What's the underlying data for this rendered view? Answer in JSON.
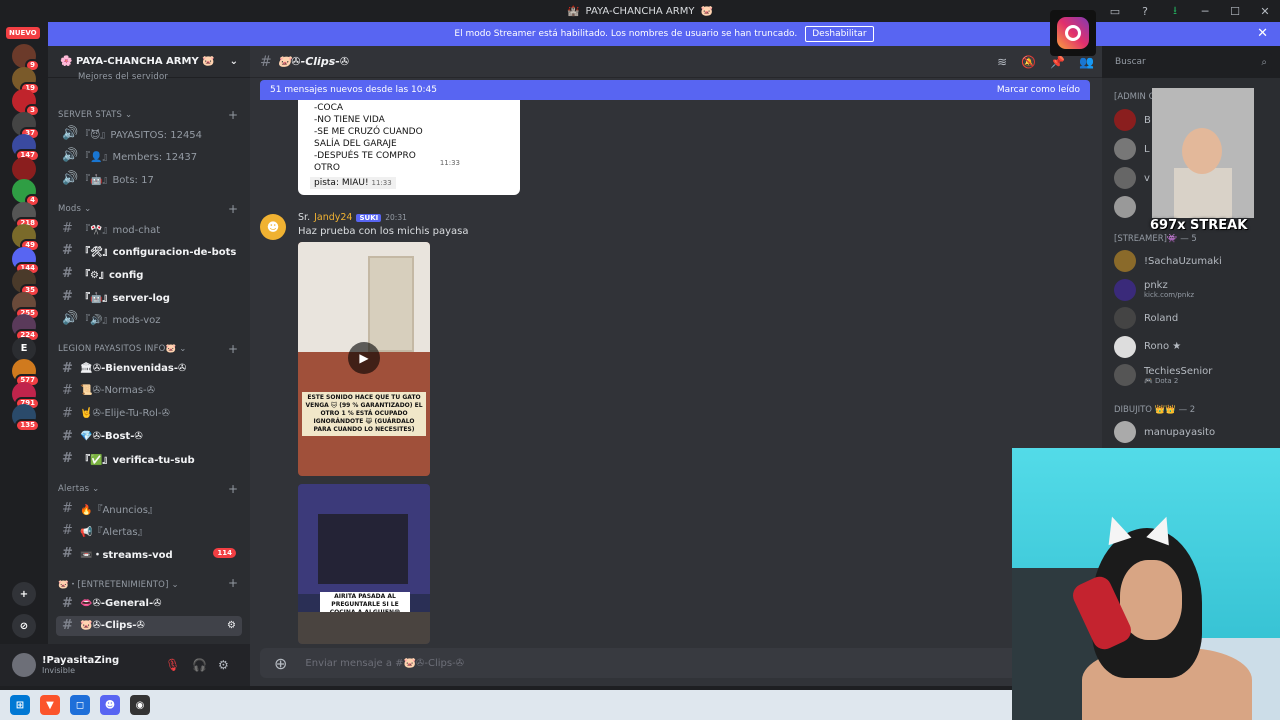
{
  "window": {
    "title": "PAYA-CHANCHA ARMY"
  },
  "banner": {
    "text": "El modo Streamer está habilitado. Los nombres de usuario se han truncado.",
    "button": "Deshabilitar"
  },
  "rail": {
    "nuevo": "NUEVO",
    "servers": [
      {
        "label": "",
        "badge": "9",
        "color": "#6b3a2a"
      },
      {
        "label": "",
        "badge": "19",
        "color": "#7a5a2a"
      },
      {
        "label": "",
        "badge": "3",
        "color": "#c0242c"
      },
      {
        "label": "",
        "badge": "37",
        "color": "#444"
      },
      {
        "label": "",
        "badge": "147",
        "color": "#3a4aa0"
      },
      {
        "label": "",
        "badge": "",
        "color": "#8a1e1e"
      },
      {
        "label": "",
        "badge": "4",
        "color": "#2f9e44"
      },
      {
        "label": "",
        "badge": "218",
        "color": "#555"
      },
      {
        "label": "",
        "badge": "49",
        "color": "#7a6a2a"
      },
      {
        "label": "",
        "badge": "144",
        "color": "#5865f2"
      },
      {
        "label": "",
        "badge": "35",
        "color": "#4a3a2a"
      },
      {
        "label": "",
        "badge": "255",
        "color": "#6a4a3a"
      },
      {
        "label": "",
        "badge": "224",
        "color": "#5a3a5a"
      },
      {
        "label": "E",
        "badge": "",
        "color": "#2b2d31"
      },
      {
        "label": "",
        "badge": "577",
        "color": "#d07a1e"
      },
      {
        "label": "",
        "badge": "791",
        "color": "#c0244c"
      },
      {
        "label": "",
        "badge": "135",
        "color": "#2a4a6a"
      }
    ]
  },
  "server": {
    "name": "PAYA-CHANCHA ARMY"
  },
  "sidebar": {
    "partial_top": "Mejores del servidor",
    "cat_stats": "SERVER STATS",
    "stats": [
      {
        "label": "『😈』PAYASITOS: 12454"
      },
      {
        "label": "『👤』Members: 12437"
      },
      {
        "label": "『🤖』Bots: 17"
      }
    ],
    "cat_mods": "Mods",
    "mods": [
      {
        "label": "『🎌』mod-chat",
        "unread": false
      },
      {
        "label": "『🛠』configuracion-de-bots",
        "unread": true
      },
      {
        "label": "『⚙』config",
        "unread": true
      },
      {
        "label": "『🤖』server-log",
        "unread": true
      },
      {
        "label": "『🔊』mods-voz",
        "unread": false
      }
    ],
    "cat_legion": "LEGION PAYASITOS INFO🐷",
    "legion": [
      {
        "label": "🏛✇-Bienvenidas-✇",
        "unread": true
      },
      {
        "label": "📜✇-Normas-✇",
        "unread": false
      },
      {
        "label": "🤘✇-Elije-Tu-Rol-✇",
        "unread": false
      },
      {
        "label": "💎✇-Bost-✇",
        "unread": true
      },
      {
        "label": "『✅』verifica-tu-sub",
        "unread": true
      }
    ],
    "cat_alertas": "Alertas",
    "alertas": [
      {
        "label": "🔥『Anuncios』",
        "unread": false,
        "count": ""
      },
      {
        "label": "📢『Alertas』",
        "unread": false,
        "count": ""
      },
      {
        "label": "📼・streams-vod",
        "unread": true,
        "count": "114"
      }
    ],
    "cat_entret": "🐷・[ENTRETENIMIENTO]",
    "entret": [
      {
        "label": "👄✇-General-✇",
        "unread": true
      },
      {
        "label": "🐷✇-Clips-✇",
        "unread": true,
        "selected": true
      }
    ]
  },
  "user": {
    "name": "!PayasitaZing",
    "status": "Invisible"
  },
  "chat": {
    "channel": "🐷✇-Clips-✇",
    "new_messages": "51 mensajes nuevos desde las 10:45",
    "mark_read": "Marcar como leído",
    "img_lines": [
      "-COCA",
      "-NO TIENE VIDA",
      "-SE ME CRUZÓ CUANDO",
      "SALÍA DEL GARAJE",
      "-DESPUÉS TE COMPRO",
      "OTRO"
    ],
    "img_time": "11:33",
    "img_pista": "pista: MIAU!",
    "img_pista_time": "11:33",
    "msg_author_prefix": "Sr. ",
    "msg_author": "Jandy24",
    "msg_tag": "SUKI",
    "msg_time": "20:31",
    "msg_text": "Haz prueba con los michis payasa",
    "vid1_caption": "ESTE SONIDO HACE QUE TU GATO VENGA 🐱 (99 % GARANTIZADO) EL OTRO 1 % ESTÁ OCUPADO IGNORÁNDOTE 😹 (GUÁRDALO PARA CUANDO LO NECESITES)",
    "vid2_caption": "AIRITA PASADA AL PREGUNTARLE SI LE COCINA A ALGUIEN😳",
    "composer_placeholder": "Enviar mensaje a #🐷✇-Clips-✇"
  },
  "members": {
    "search_placeholder": "Buscar",
    "cat_admin": "[ADMIN C",
    "cat_streamer": "[STREAMER]👾 — 5",
    "streamers": [
      {
        "name": "!SachaUzumaki",
        "sub": ""
      },
      {
        "name": "pnkz",
        "sub": "kick.com/pnkz"
      },
      {
        "name": "Roland",
        "sub": ""
      },
      {
        "name": "Rono ★",
        "sub": ""
      },
      {
        "name": "TechiesSenior",
        "sub": "🎮 Dota 2"
      }
    ],
    "cat_dibujito": "DIBUJITO 👑👑 — 2",
    "dibujito": [
      {
        "name": "manupayasito"
      }
    ],
    "admin_initials": [
      "B",
      "L",
      "v",
      ""
    ]
  },
  "overlay": {
    "streak": "697x STREAK"
  },
  "colors": {
    "accent": "#5865f2",
    "badge": "#f23f43",
    "author": "#f0b232"
  }
}
